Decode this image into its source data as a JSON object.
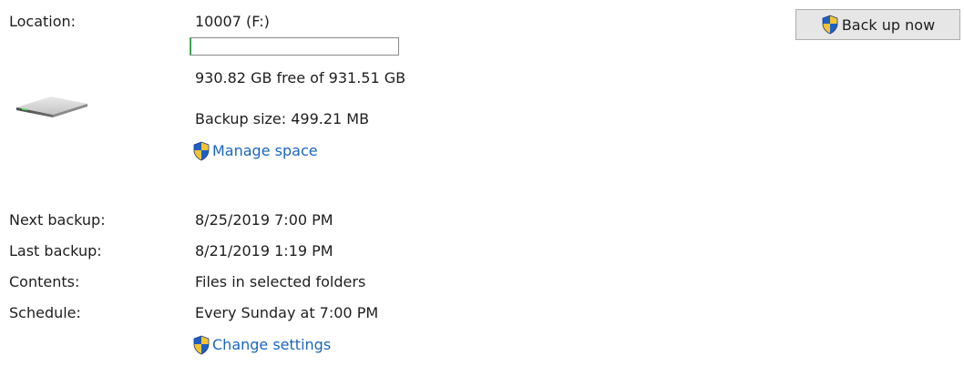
{
  "location": {
    "label": "Location:",
    "drive_name": "10007 (F:)",
    "used_fraction": 0.0007,
    "free_text": "930.82 GB free of 931.51 GB",
    "backup_size": "Backup size: 499.21 MB",
    "drive_icon": "hard-drive-icon",
    "usage_bar_color": "#06b025"
  },
  "manage_space": {
    "label": "Manage space",
    "icon": "uac-shield-icon"
  },
  "back_up_now": {
    "label": "Back up now",
    "icon": "uac-shield-icon"
  },
  "details": [
    {
      "label": "Next backup:",
      "value": "8/25/2019 7:00 PM"
    },
    {
      "label": "Last backup:",
      "value": "8/21/2019 1:19 PM"
    },
    {
      "label": "Contents:",
      "value": "Files in selected folders"
    },
    {
      "label": "Schedule:",
      "value": "Every Sunday at 7:00 PM"
    }
  ],
  "change_settings": {
    "label": "Change settings",
    "icon": "uac-shield-icon"
  },
  "colors": {
    "link": "#1a66c2",
    "text": "#1e1e1e",
    "button_bg": "#e6e6e6",
    "shield_blue": "#1f5fc4",
    "shield_yellow": "#f4c430"
  }
}
